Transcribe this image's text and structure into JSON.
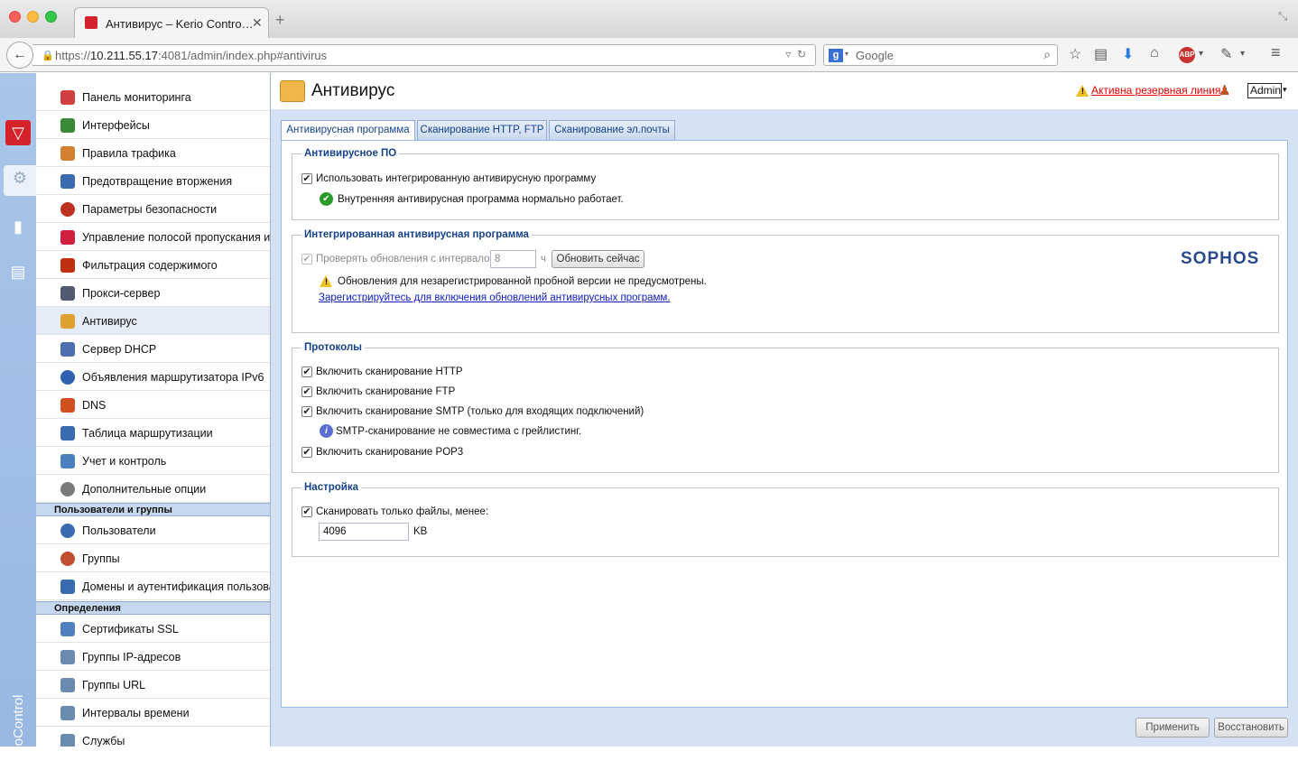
{
  "browser": {
    "tab_title": "Антивирус – Kerio Contro…",
    "url_prefix": "https://",
    "url_host": "10.211.55.17",
    "url_rest": ":4081/admin/index.php#antivirus",
    "search_placeholder": "Google"
  },
  "brand": "KerioControl",
  "sidebar": {
    "items": [
      {
        "label": "Панель мониторинга",
        "color": "#d04040"
      },
      {
        "label": "Интерфейсы",
        "color": "#3a8a3a"
      },
      {
        "label": "Правила трафика",
        "color": "#d08030"
      },
      {
        "label": "Предотвращение вторжения",
        "color": "#3a6ab0"
      },
      {
        "label": "Параметры безопасности",
        "color": "#c03020"
      },
      {
        "label": "Управление полосой пропускания и С",
        "color": "#d02040"
      },
      {
        "label": "Фильтрация содержимого",
        "color": "#c03010"
      },
      {
        "label": "Прокси-сервер",
        "color": "#505a70"
      },
      {
        "label": "Антивирус",
        "color": "#e0a030"
      },
      {
        "label": "Сервер DHCP",
        "color": "#4a70b0"
      },
      {
        "label": "Объявления маршрутизатора IPv6",
        "color": "#3060b0"
      },
      {
        "label": "DNS",
        "color": "#d05020"
      },
      {
        "label": "Таблица маршрутизации",
        "color": "#3a6ab0"
      },
      {
        "label": "Учет и контроль",
        "color": "#4a80c0"
      },
      {
        "label": "Дополнительные опции",
        "color": "#7a7a7a"
      }
    ],
    "section_users": "Пользователи и группы",
    "users_items": [
      {
        "label": "Пользователи",
        "color": "#3a6ab0"
      },
      {
        "label": "Группы",
        "color": "#c05030"
      },
      {
        "label": "Домены и аутентификация пользоват",
        "color": "#3a6ab0"
      }
    ],
    "section_defs": "Определения",
    "defs_items": [
      {
        "label": "Сертификаты SSL",
        "color": "#5080c0"
      },
      {
        "label": "Группы IP-адресов",
        "color": "#6a8ab0"
      },
      {
        "label": "Группы URL",
        "color": "#6a8ab0"
      },
      {
        "label": "Интервалы времени",
        "color": "#6a8ab0"
      },
      {
        "label": "Службы",
        "color": "#6a8ab0"
      }
    ]
  },
  "header": {
    "title": "Антивирус",
    "warning_link": "Активна резервная линия",
    "user_menu": "Admin"
  },
  "tabs": [
    "Антивирусная программа",
    "Сканирование HTTP, FTP",
    "Сканирование эл.почты"
  ],
  "sections": {
    "av": {
      "title": "Антивирусное ПО",
      "use_integrated": "Использовать интегрированную антивирусную программу",
      "status": "Внутренняя антивирусная программа нормально работает."
    },
    "integrated": {
      "title": "Интегрированная антивирусная программа",
      "check_updates": "Проверять обновления с интервалом",
      "interval_value": "8",
      "interval_unit": "ч",
      "update_now": "Обновить сейчас",
      "warning": "Обновления для незарегистрированной пробной версии не предусмотрены.",
      "register_link": "Зарегистрируйтесь для включения обновлений антивирусных программ.",
      "vendor": "SOPHOS"
    },
    "protocols": {
      "title": "Протоколы",
      "http": "Включить сканирование HTTP",
      "ftp": "Включить сканирование FTP",
      "smtp": "Включить сканирование SMTP (только для входящих подключений)",
      "smtp_note": "SMTP-сканирование не совместима с грейлистинг.",
      "pop3": "Включить сканирование POP3"
    },
    "settings": {
      "title": "Настройка",
      "scan_only": "Сканировать только файлы, менее:",
      "size_value": "4096",
      "size_unit": "KB"
    }
  },
  "footer": {
    "apply": "Применить",
    "restore": "Восстановить"
  }
}
